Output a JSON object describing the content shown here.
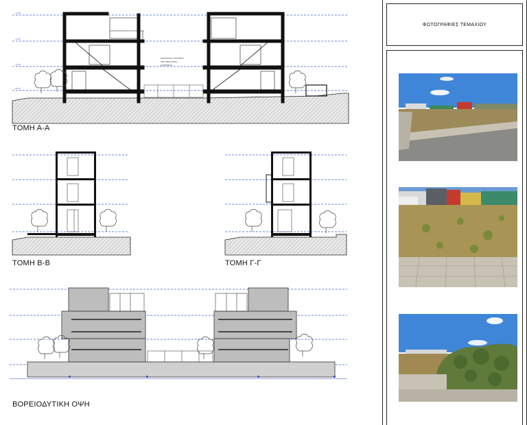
{
  "sections": {
    "section_aa": "ΤΟΜΗ Α-Α",
    "section_bb": "ΤΟΜΗ Β-Β",
    "section_gg": "ΤΟΜΗ Γ-Γ",
    "elevation": "ΒΟΡΕΙΟΔΥΤΙΚΗ ΟΨΗ"
  },
  "sidebar": {
    "title": "ΦΩΤΟΓΡΑΦΙΕΣ ΤΕΜΑΧΙΟΥ",
    "photos": [
      {
        "name": "plot-photo-1"
      },
      {
        "name": "plot-photo-2"
      },
      {
        "name": "plot-photo-3"
      }
    ]
  },
  "colors": {
    "level_line": "#3a5bd9",
    "wall": "#111111",
    "ground_hatch": "#c8c8c8",
    "elevation_fill": "#bdbdbd",
    "sky": "#3f86d8",
    "dry_grass": "#b59a5a",
    "paving": "#c8c2b4"
  }
}
